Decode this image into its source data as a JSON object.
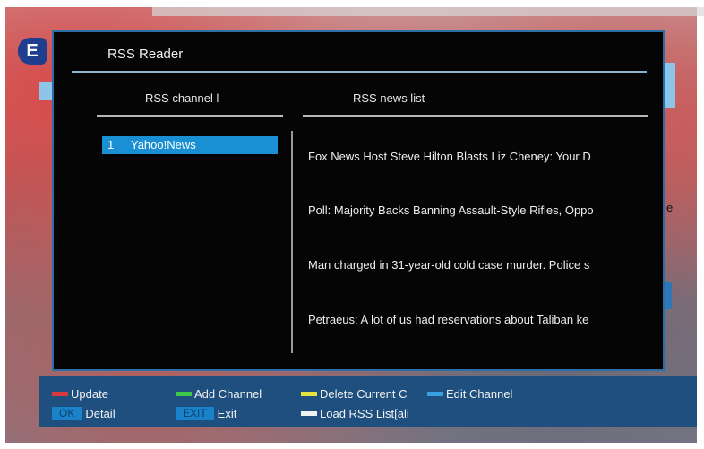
{
  "dialog": {
    "title": "RSS Reader",
    "badge": "E"
  },
  "columns": {
    "channel_header": "RSS channel l",
    "news_header": "RSS news list"
  },
  "channels": [
    {
      "num": "1",
      "name": "Yahoo!News",
      "selected": true
    }
  ],
  "news": [
    "Fox News Host Steve Hilton Blasts Liz Cheney: Your D",
    "Poll: Majority Backs Banning Assault-Style Rifles, Oppo",
    "Man charged in 31-year-old cold case murder. Police s",
    "Petraeus: A lot of us had reservations about Taliban ke"
  ],
  "stray_text": "e",
  "footer": {
    "update": {
      "label": "Update",
      "color": "#d63a3a"
    },
    "add_channel": {
      "label": "Add Channel",
      "color": "#3ec84a"
    },
    "delete_current": {
      "label": "Delete Current C",
      "color": "#e8e040"
    },
    "edit_channel": {
      "label": "Edit Channel",
      "color": "#3aa0e0"
    },
    "ok": {
      "key": "OK",
      "label": "Detail"
    },
    "exit": {
      "key": "EXIT",
      "label": "Exit"
    },
    "load_rss": {
      "label": "Load RSS List[ali",
      "color": "#f0f0f0"
    }
  }
}
